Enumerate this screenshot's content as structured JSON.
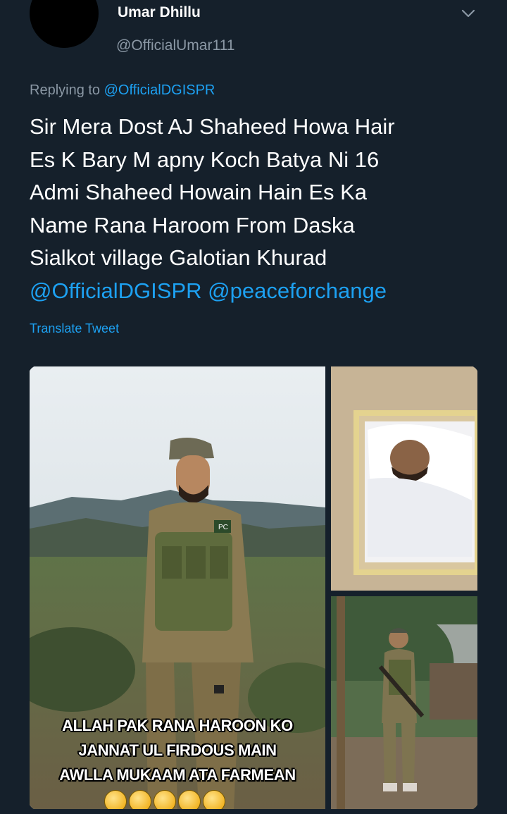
{
  "author": {
    "name": "Umar Dhillu",
    "handle": "@OfficialUmar111"
  },
  "reply": {
    "prefix": "Replying to ",
    "handle": "@OfficialDGISPR"
  },
  "tweet": {
    "lines": [
      "Sir Mera Dost AJ Shaheed Howa Hair",
      "Es K Bary M apny Koch Batya Ni 16",
      "Admi Shaheed Howain Hain Es Ka",
      "Name Rana Haroom From Daska",
      "Sialkot village Galotian Khurad"
    ],
    "mentions": [
      "@OfficialDGISPR",
      "@peaceforchange"
    ]
  },
  "translate_label": "Translate Tweet",
  "media": {
    "left_image": {
      "caption_lines": [
        "ALLAH PAK RANA HAROON KO",
        "JANNAT UL FIRDOUS MAIN",
        "AWLLA MUKAAM ATA FARMEAN"
      ],
      "patch_text": "PC",
      "emoji": [
        "crying-face",
        "crying-face",
        "crying-face",
        "crying-face",
        "crying-face"
      ]
    },
    "top_right_image": "framed-photo",
    "bottom_right_image": "soldier-standing-photo"
  },
  "colors": {
    "background": "#15202b",
    "accent": "#1da1f2",
    "secondary_text": "#8b98a5"
  }
}
